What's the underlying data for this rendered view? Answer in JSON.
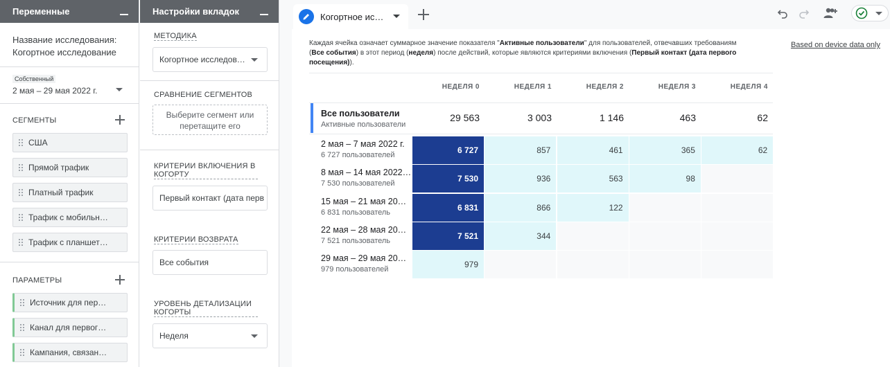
{
  "variables_panel": {
    "title": "Переменные",
    "study_name_label": "Название исследования:",
    "study_name_value": "Когортное исследование",
    "date_chip_label": "Собственный",
    "date_range": "2 мая – 29 мая 2022 г.",
    "segments_header": "СЕГМЕНТЫ",
    "segments": [
      "США",
      "Прямой трафик",
      "Платный трафик",
      "Трафик с мобильн…",
      "Трафик с планшет…"
    ],
    "parameters_header": "ПАРАМЕТРЫ",
    "parameters": [
      "Источник для пер…",
      "Канал для первог…",
      "Кампания, связан…"
    ]
  },
  "tab_settings_panel": {
    "title": "Настройки вкладок",
    "method_label": "МЕТОДИКА",
    "method_value": "Когортное исследова…",
    "segment_compare_label": "СРАВНЕНИЕ СЕГМЕНТОВ",
    "segment_drop_text": "Выберите сегмент или перетащите его",
    "inclusion_label": "КРИТЕРИИ ВКЛЮЧЕНИЯ В КОГОРТУ",
    "inclusion_value": "Первый контакт (дата перв",
    "return_label": "КРИТЕРИИ ВОЗВРАТА",
    "return_value": "Все события",
    "granularity_label": "УРОВЕНЬ ДЕТАЛИЗАЦИИ КОГОРТЫ",
    "granularity_value": "Неделя"
  },
  "tabbar": {
    "active_tab_label": "Когортное ис…",
    "icons": [
      "pencil-icon",
      "chevron-down-icon",
      "add-tab-icon",
      "undo-icon",
      "redo-icon",
      "share-users-icon",
      "check-circle-icon"
    ]
  },
  "canvas": {
    "description_parts": [
      "Каждая ячейка означает суммарное значение показателя \"",
      "Активные пользователи",
      "\" для пользователей, отвечавших требованиям (",
      "Все события",
      ") в этот период (",
      "неделя",
      ") после действий, которые являются критериями включения (",
      "Первый контакт (дата первого посещения)",
      ")."
    ],
    "device_note": "Based on device data only",
    "columns": [
      "НЕДЕЛЯ 0",
      "НЕДЕЛЯ 1",
      "НЕДЕЛЯ 2",
      "НЕДЕЛЯ 3",
      "НЕДЕЛЯ 4"
    ],
    "total_row": {
      "title": "Все пользователи",
      "subtitle": "Активные пользователи",
      "values": [
        "29 563",
        "3 003",
        "1 146",
        "463",
        "62"
      ]
    },
    "rows": [
      {
        "title": "2 мая – 7 мая 2022 г.",
        "subtitle": "6 727 пользователей",
        "cells": [
          "6 727",
          "857",
          "461",
          "365",
          "62"
        ]
      },
      {
        "title": "8 мая – 14 мая 2022…",
        "subtitle": "7 530 пользователей",
        "cells": [
          "7 530",
          "936",
          "563",
          "98",
          ""
        ]
      },
      {
        "title": "15 мая – 21 мая 20…",
        "subtitle": "6 831 пользователь",
        "cells": [
          "6 831",
          "866",
          "122",
          "",
          ""
        ]
      },
      {
        "title": "22 мая – 28 мая 20…",
        "subtitle": "7 521 пользователь",
        "cells": [
          "7 521",
          "344",
          "",
          "",
          ""
        ]
      },
      {
        "title": "29 мая – 29 мая 20…",
        "subtitle": "979 пользователей",
        "cells": [
          "979",
          "",
          "",
          "",
          ""
        ]
      }
    ],
    "colors": {
      "strong": "#1c3d91",
      "weak": "#e0f7fa",
      "empty": "#f8f9fa",
      "total_accent": "#4285f4"
    }
  }
}
